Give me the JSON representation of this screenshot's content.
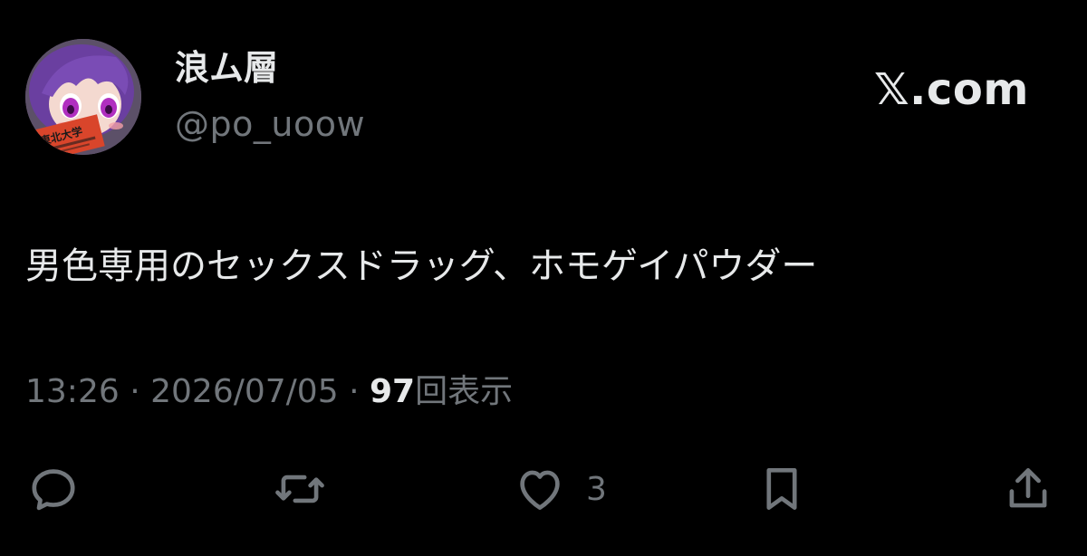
{
  "author": {
    "display_name": "浪ム層",
    "handle": "@po_uoow",
    "avatar_sign_text": "東北大学"
  },
  "brand": "𝕏.com",
  "tweet": {
    "text": "男色専用のセックスドラッグ、ホモゲイパウダー",
    "time": "13:26",
    "date": "2026/07/05",
    "separator": "·",
    "views": "97",
    "views_label": "回表示"
  },
  "actions": {
    "reply": {
      "icon": "reply-icon"
    },
    "repost": {
      "icon": "repost-icon"
    },
    "like": {
      "icon": "heart-icon",
      "count": "3"
    },
    "bookmark": {
      "icon": "bookmark-icon"
    },
    "share": {
      "icon": "share-icon"
    }
  },
  "colors": {
    "background": "#000000",
    "text_primary": "#e7e9ea",
    "text_secondary": "#71767b",
    "avatar_hair": "#6a3fa0",
    "avatar_sign": "#d9452b"
  }
}
